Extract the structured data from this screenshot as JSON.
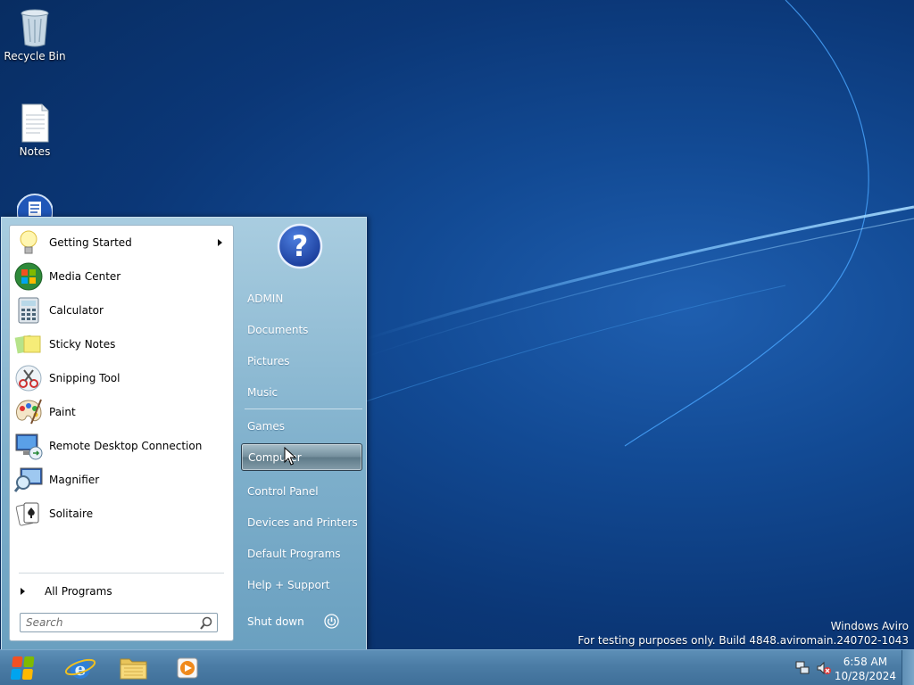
{
  "desktop": {
    "icons": [
      {
        "label": "Recycle Bin",
        "icon": "recycle-bin-icon"
      },
      {
        "label": "Notes",
        "icon": "text-file-icon"
      },
      {
        "label": "",
        "icon": "notepad-app-icon"
      }
    ],
    "watermark": {
      "line1": "Windows Aviro",
      "line2": "For testing purposes only. Build 4848.aviromain.240702-1043"
    }
  },
  "start_menu": {
    "programs": [
      {
        "label": "Getting Started",
        "icon": "lightbulb-icon",
        "has_submenu": true
      },
      {
        "label": "Media Center",
        "icon": "media-center-icon"
      },
      {
        "label": "Calculator",
        "icon": "calculator-icon"
      },
      {
        "label": "Sticky Notes",
        "icon": "sticky-notes-icon"
      },
      {
        "label": "Snipping Tool",
        "icon": "scissors-icon"
      },
      {
        "label": "Paint",
        "icon": "paint-palette-icon"
      },
      {
        "label": "Remote Desktop Connection",
        "icon": "remote-desktop-icon"
      },
      {
        "label": "Magnifier",
        "icon": "magnifier-icon"
      },
      {
        "label": "Solitaire",
        "icon": "playing-cards-icon"
      }
    ],
    "all_programs_label": "All Programs",
    "search_placeholder": "Search",
    "user_icon": "help-question-icon",
    "links": [
      "ADMIN",
      "Documents",
      "Pictures",
      "Music",
      "Games",
      "Computer",
      "Control Panel",
      "Devices and Printers",
      "Default Programs",
      "Help + Support"
    ],
    "highlighted_link": "Computer",
    "shutdown_label": "Shut down"
  },
  "taskbar": {
    "pinned": [
      "start-orb-icon",
      "internet-explorer-icon",
      "file-explorer-icon",
      "media-player-icon"
    ],
    "tray": [
      "network-icon",
      "volume-muted-icon"
    ],
    "time": "6:58 AM",
    "date": "10/28/2024"
  }
}
